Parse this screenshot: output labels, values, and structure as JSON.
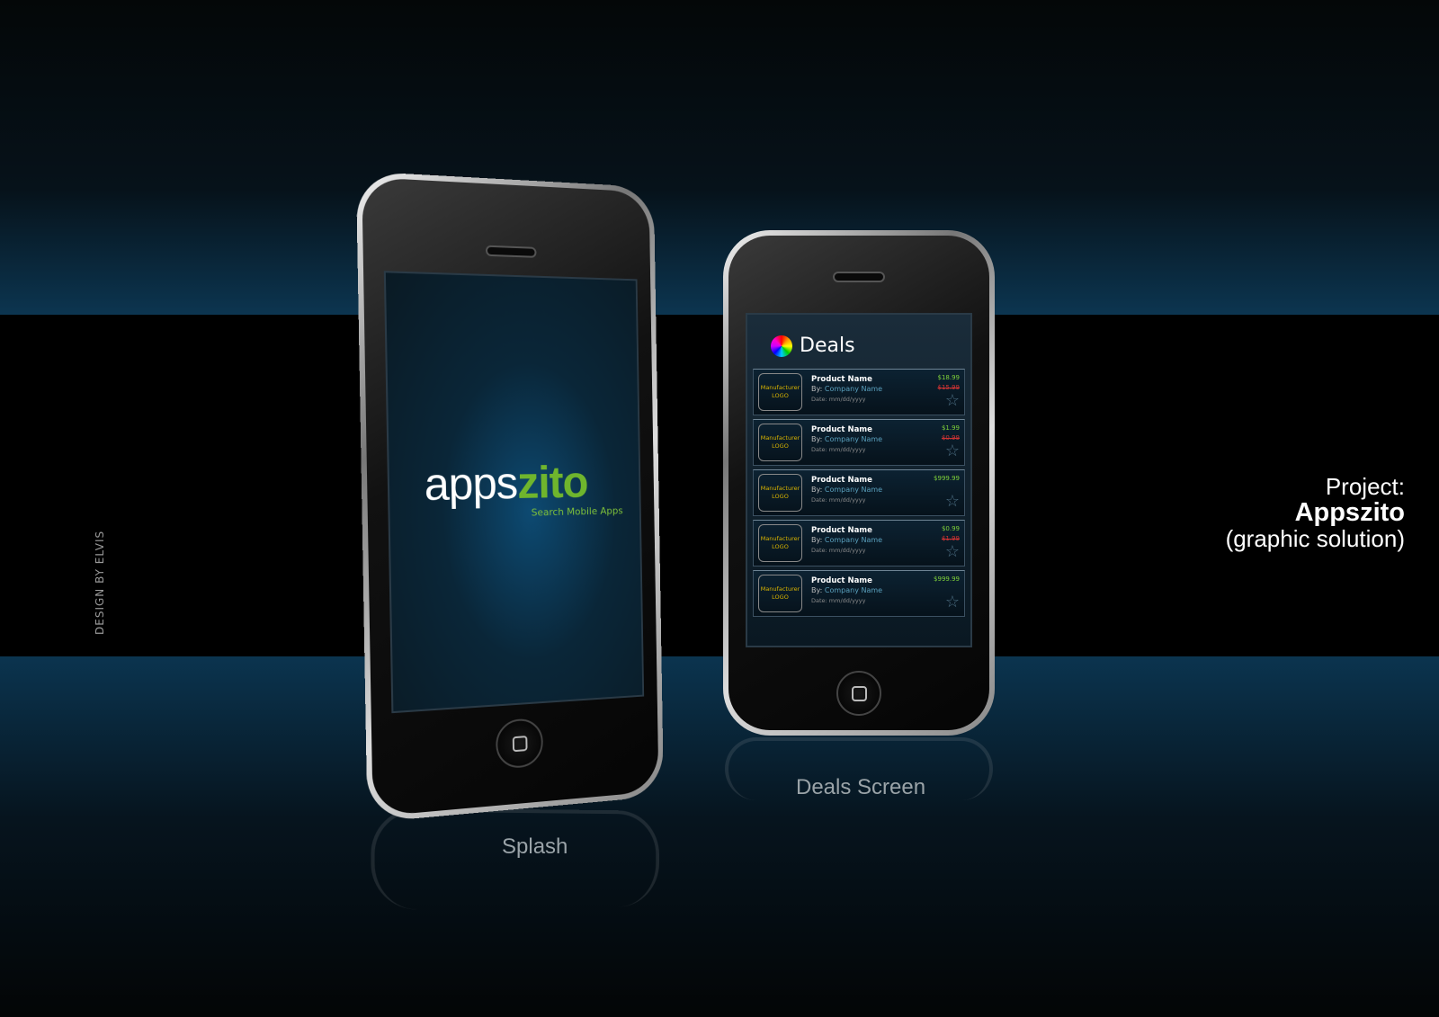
{
  "credit": "DESIGN  BY ELVIS",
  "project": {
    "label": "Project:",
    "name": "Appszito",
    "subtitle": "(graphic solution)"
  },
  "splash": {
    "logo_part1": "apps",
    "logo_part2": "zito",
    "tagline": "Search Mobile Apps",
    "caption": "Splash"
  },
  "deals": {
    "title": "Deals",
    "caption": "Deals Screen",
    "items": [
      {
        "logo_line1": "Manufacturer",
        "logo_line2": "LOGO",
        "name": "Product Name",
        "by": "By:",
        "company": "Company Name",
        "date": "Date: mm/dd/yyyy",
        "price": "$18.99",
        "old_price": "$15.99"
      },
      {
        "logo_line1": "Manufacturer",
        "logo_line2": "LOGO",
        "name": "Product Name",
        "by": "By:",
        "company": "Company Name",
        "date": "Date: mm/dd/yyyy",
        "price": "$1.99",
        "old_price": "$0.99"
      },
      {
        "logo_line1": "Manufacturer",
        "logo_line2": "LOGO",
        "name": "Product Name",
        "by": "By:",
        "company": "Company Name",
        "date": "Date: mm/dd/yyyy",
        "price": "$999.99",
        "old_price": ""
      },
      {
        "logo_line1": "Manufacturer",
        "logo_line2": "LOGO",
        "name": "Product Name",
        "by": "By:",
        "company": "Company Name",
        "date": "Date: mm/dd/yyyy",
        "price": "$0.99",
        "old_price": "$1.99"
      },
      {
        "logo_line1": "Manufacturer",
        "logo_line2": "LOGO",
        "name": "Product Name",
        "by": "By:",
        "company": "Company Name",
        "date": "Date: mm/dd/yyyy",
        "price": "$999.99",
        "old_price": ""
      }
    ]
  },
  "colors": {
    "accent_green": "#7fd13a",
    "logo_yellow": "#d8b400",
    "company_blue": "#5aa0bd"
  }
}
